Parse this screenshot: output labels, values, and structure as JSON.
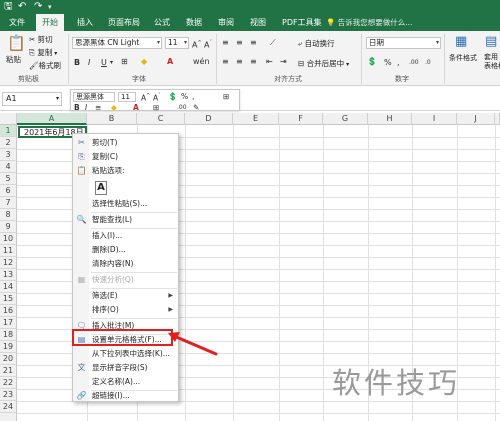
{
  "quick_access": {
    "save_icon": "save-icon",
    "undo_icon": "undo-icon",
    "redo_icon": "redo-icon"
  },
  "tabs": [
    "文件",
    "开始",
    "插入",
    "页面布局",
    "公式",
    "数据",
    "审阅",
    "视图",
    "PDF工具集"
  ],
  "active_tab": "开始",
  "tell_me_placeholder": "告诉我您想要做什么...",
  "ribbon": {
    "clipboard": {
      "label": "剪贴板",
      "paste": "粘贴",
      "cut": "剪切",
      "copy": "复制",
      "format_painter": "格式刷"
    },
    "font": {
      "label": "字体",
      "font_name": "思源黑体 CN Light",
      "font_size": "11",
      "bold": "B",
      "italic": "I",
      "underline": "U"
    },
    "alignment": {
      "label": "对齐方式",
      "wrap_text": "自动换行",
      "merge_center": "合并后居中"
    },
    "number": {
      "label": "数字",
      "format": "日期",
      "percent": "%",
      "comma": ","
    },
    "styles": {
      "conditional_format": "条件格式",
      "table_format": "套用\n表格格式"
    }
  },
  "name_box": "A1",
  "mini_toolbar": {
    "font_name": "思源黑体",
    "font_size": "11",
    "bold": "B",
    "italic": "I",
    "percent": "%",
    "comma": ","
  },
  "columns": [
    "A",
    "B",
    "C",
    "D",
    "E",
    "F",
    "G",
    "H",
    "I",
    "J",
    "K"
  ],
  "selected_column": "A",
  "rows": [
    "1",
    "2",
    "3",
    "4",
    "5",
    "6",
    "7",
    "8",
    "9",
    "10",
    "11",
    "12",
    "13",
    "14",
    "15",
    "16",
    "17",
    "18",
    "19",
    "20",
    "21",
    "22",
    "23",
    "24"
  ],
  "selected_row": "1",
  "cell_a1": "2021年6月18日",
  "context_menu": {
    "cut": "剪切(T)",
    "copy": "复制(C)",
    "paste_options": "粘贴选项:",
    "paste_special": "选择性粘贴(S)...",
    "smart_lookup": "智能查找(L)",
    "insert": "插入(I)...",
    "delete": "删除(D)...",
    "clear_contents": "清除内容(N)",
    "quick_analysis": "快速分析(Q)",
    "filter": "筛选(E)",
    "sort": "排序(O)",
    "insert_comment": "插入批注(M)",
    "format_cells": "设置单元格格式(F)...",
    "pick_from_list": "从下拉列表中选择(K)...",
    "phonetic": "显示拼音字段(S)",
    "define_name": "定义名称(A)...",
    "hyperlink": "超链接(I)..."
  },
  "watermark": "软件技巧",
  "colors": {
    "excel_green": "#217346",
    "highlight_red": "#e02020"
  }
}
